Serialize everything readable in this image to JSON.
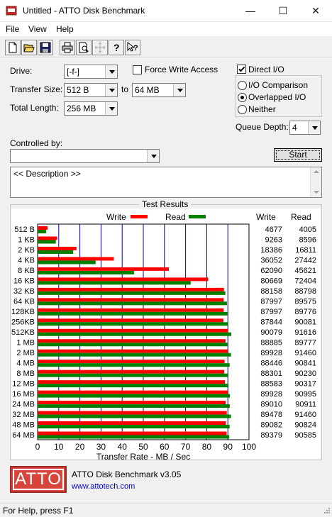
{
  "window": {
    "title": "Untitled - ATTO Disk Benchmark",
    "minimize": "—",
    "maximize": "☐",
    "close": "✕"
  },
  "menu": [
    "File",
    "View",
    "Help"
  ],
  "toolbar_icons": [
    "new-icon",
    "open-icon",
    "save-icon",
    "print-icon",
    "print-preview-icon",
    "move-icon",
    "about-icon",
    "context-help-icon"
  ],
  "settings": {
    "drive_label": "Drive:",
    "drive_value": "[-f-]",
    "transfer_size_label": "Transfer Size:",
    "transfer_from": "512 B",
    "to_label": "to",
    "transfer_to": "64 MB",
    "total_length_label": "Total Length:",
    "total_length_value": "256 MB",
    "force_write_label": "Force Write Access",
    "force_write_checked": false,
    "direct_io_label": "Direct I/O",
    "direct_io_checked": true,
    "io_comparison_label": "I/O Comparison",
    "overlapped_io_label": "Overlapped I/O",
    "neither_label": "Neither",
    "selected_mode": "Overlapped I/O",
    "queue_depth_label": "Queue Depth:",
    "queue_depth_value": "4",
    "controlled_by_label": "Controlled by:",
    "controlled_by_value": "",
    "start_label": "Start",
    "description_text": "<< Description >>"
  },
  "results": {
    "title": "Test Results",
    "write_legend": "Write",
    "read_legend": "Read",
    "write_color": "#ff0000",
    "read_color": "#008000",
    "write_col_header": "Write",
    "read_col_header": "Read"
  },
  "chart_data": {
    "type": "bar",
    "orientation": "horizontal",
    "xlabel": "Transfer Rate - MB / Sec",
    "xlim": [
      0,
      100
    ],
    "xticks": [
      0,
      10,
      20,
      30,
      40,
      50,
      60,
      70,
      80,
      90,
      100
    ],
    "categories": [
      "512 B",
      "1 KB",
      "2 KB",
      "4 KB",
      "8 KB",
      "16 KB",
      "32 KB",
      "64 KB",
      "128KB",
      "256KB",
      "512KB",
      "1 MB",
      "2 MB",
      "4 MB",
      "8 MB",
      "12 MB",
      "16 MB",
      "24 MB",
      "32 MB",
      "48 MB",
      "64 MB"
    ],
    "series": [
      {
        "name": "Write",
        "values": [
          4677,
          9263,
          18386,
          36052,
          62090,
          80669,
          88158,
          87997,
          87997,
          87844,
          90079,
          88885,
          89928,
          88446,
          88301,
          88583,
          89928,
          89010,
          89478,
          89082,
          89379
        ]
      },
      {
        "name": "Read",
        "values": [
          4005,
          8596,
          16811,
          27442,
          45621,
          72404,
          88798,
          89575,
          89776,
          90081,
          91616,
          89777,
          91460,
          90841,
          90230,
          90317,
          90995,
          90911,
          91460,
          90824,
          90585
        ]
      }
    ],
    "grid": true,
    "legend": "top"
  },
  "footer": {
    "logo_text": "ATTO",
    "product": "ATTO Disk Benchmark v3.05",
    "link": "www.attotech.com"
  },
  "status": "For Help, press F1"
}
